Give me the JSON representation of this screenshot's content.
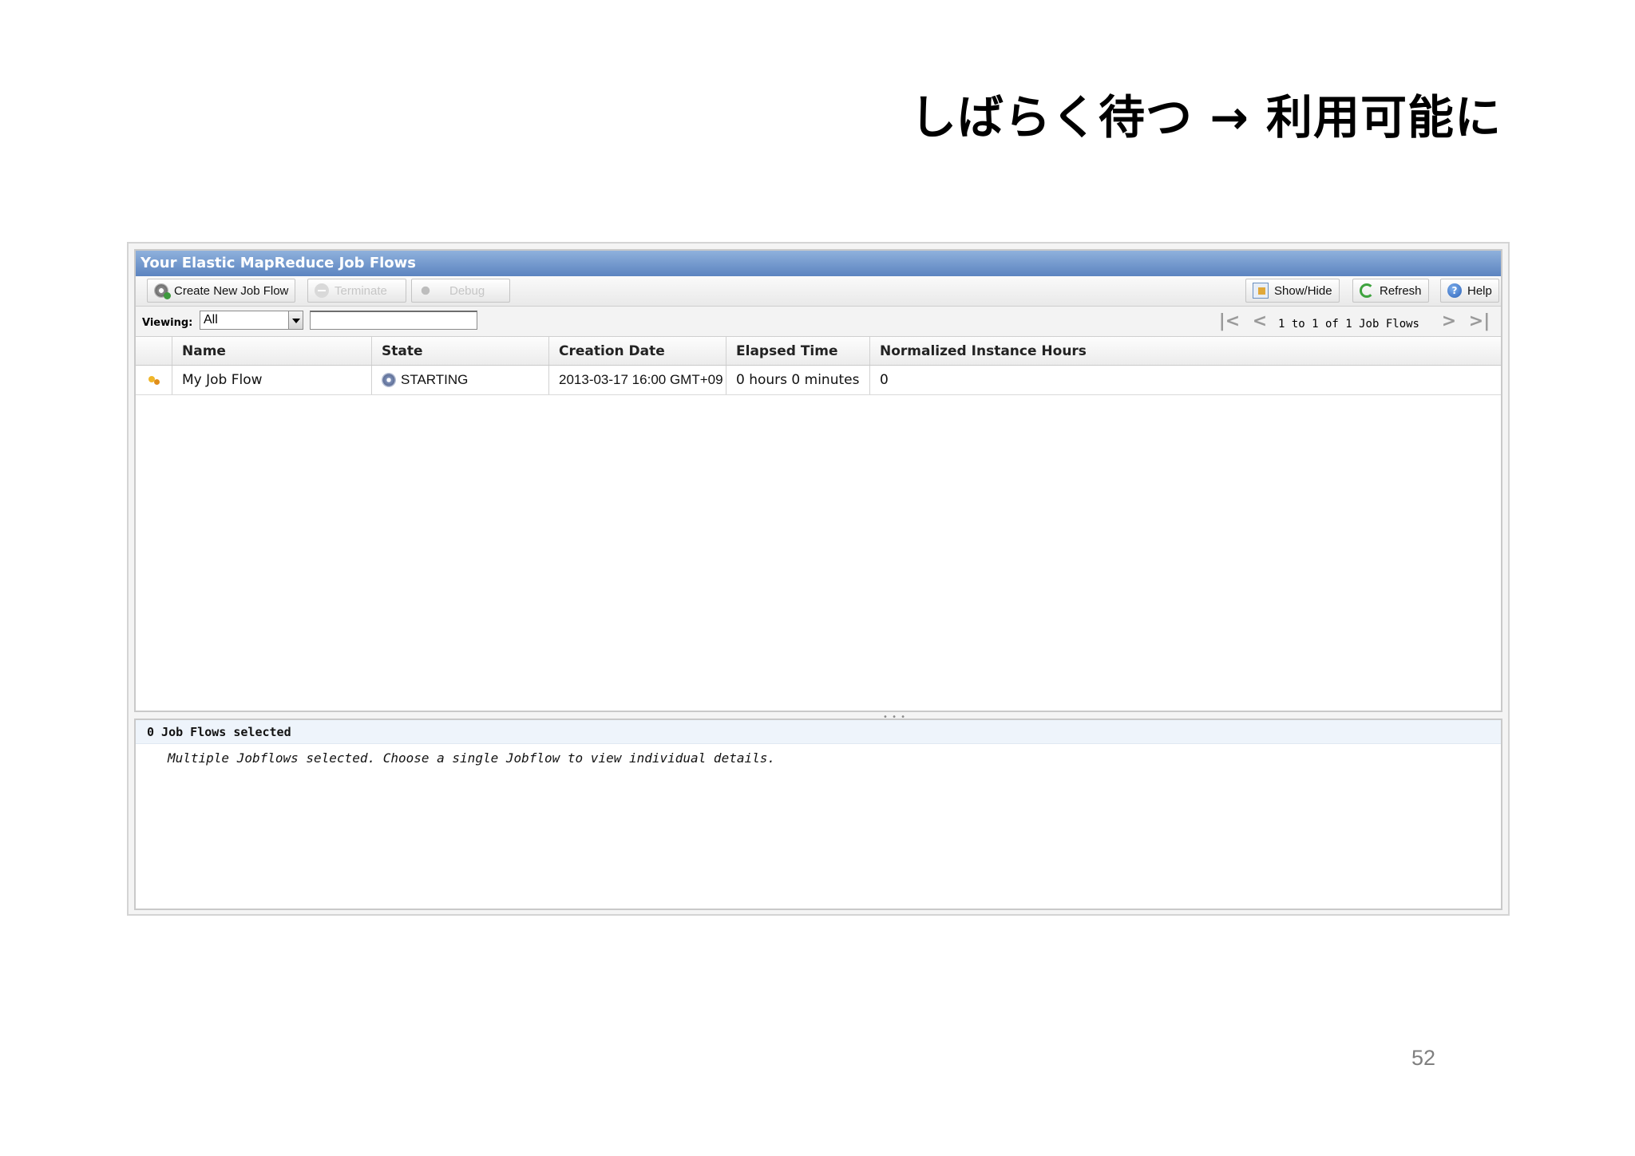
{
  "slide": {
    "title": "しばらく待つ → 利用可能に",
    "page_number": "52"
  },
  "panel": {
    "title": "Your Elastic MapReduce Job Flows"
  },
  "toolbar": {
    "create_label": "Create New Job Flow",
    "terminate_label": "Terminate",
    "debug_label": "Debug",
    "showhide_label": "Show/Hide",
    "refresh_label": "Refresh",
    "help_label": "Help"
  },
  "viewing": {
    "label": "Viewing:",
    "selected": "All",
    "filter_value": ""
  },
  "pager": {
    "text": "1 to 1 of 1 Job Flows"
  },
  "grid": {
    "columns": [
      "Name",
      "State",
      "Creation Date",
      "Elapsed Time",
      "Normalized Instance Hours"
    ],
    "rows": [
      {
        "name": "My Job Flow",
        "state": "STARTING",
        "creation_date": "2013-03-17 16:00 GMT+09",
        "elapsed_time": "0 hours 0 minutes",
        "normalized_instance_hours": "0"
      }
    ]
  },
  "details": {
    "header": "0 Job Flows selected",
    "message": "Multiple Jobflows selected. Choose a single Jobflow to view individual details."
  },
  "icons": {
    "create": "gear-plus-icon",
    "terminate": "stop-icon",
    "debug": "bug-icon",
    "showhide": "columns-icon",
    "refresh": "refresh-icon",
    "help": "help-icon",
    "starting": "sparkle-icon",
    "state": "gear-icon"
  },
  "colors": {
    "header_blue": "#5c84c0",
    "panel_border": "#c9c9c9"
  }
}
